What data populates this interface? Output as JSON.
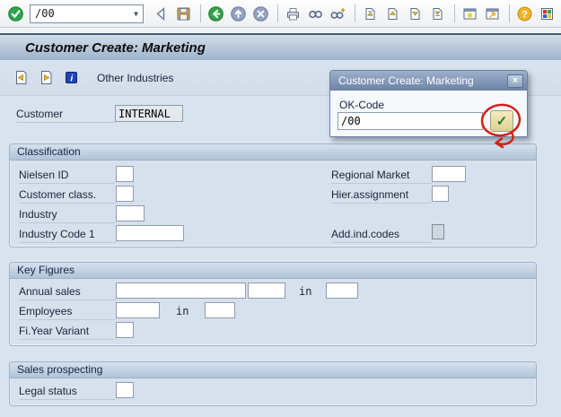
{
  "window": {
    "title": "Customer Create: Marketing"
  },
  "toolbar": {
    "command_value": "/00",
    "dropdown_glyph": "▼",
    "icons": [
      "enter-icon",
      "command-field",
      "back-triangle-icon",
      "save-icon",
      "back-icon",
      "exit-icon",
      "cancel-icon",
      "print-icon",
      "find-icon",
      "find-next-icon",
      "first-page-icon",
      "previous-page-icon",
      "next-page-icon",
      "last-page-icon",
      "new-session-icon",
      "create-shortcut-icon",
      "help-icon",
      "customize-layout-icon"
    ]
  },
  "app_toolbar": {
    "button_label": "Other Industries",
    "icons": [
      "previous-screen-icon",
      "next-screen-icon",
      "info-icon"
    ]
  },
  "customer": {
    "label": "Customer",
    "value": "INTERNAL"
  },
  "classification": {
    "title": "Classification",
    "nielsen_label": "Nielsen ID",
    "cust_class_label": "Customer class.",
    "industry_label": "Industry",
    "industry_code_label": "Industry Code 1",
    "regional_label": "Regional Market",
    "hier_label": "Hier.assignment",
    "addind_label": "Add.ind.codes"
  },
  "key_figures": {
    "title": "Key Figures",
    "annual_label": "Annual sales",
    "in1": "in",
    "employees_label": "Employees",
    "in2": "in",
    "fiyear_label": "Fi.Year Variant"
  },
  "sales_prospecting": {
    "title": "Sales prospecting",
    "legal_label": "Legal status"
  },
  "popup": {
    "title": "Customer Create: Marketing",
    "close_glyph": "×",
    "ok_code_label": "OK-Code",
    "ok_code_value": "/00",
    "confirm_glyph": "✓"
  },
  "colors": {
    "page_bg": "#d9e3ee",
    "titlebar_gradient_top": "#d3deea",
    "titlebar_gradient_bottom": "#9db3cb",
    "group_header_bottom": "#b0c3d9",
    "popup_title_bottom": "#6d83a5",
    "annotation_red": "#d42015",
    "confirm_green": "#1d7a2a"
  }
}
